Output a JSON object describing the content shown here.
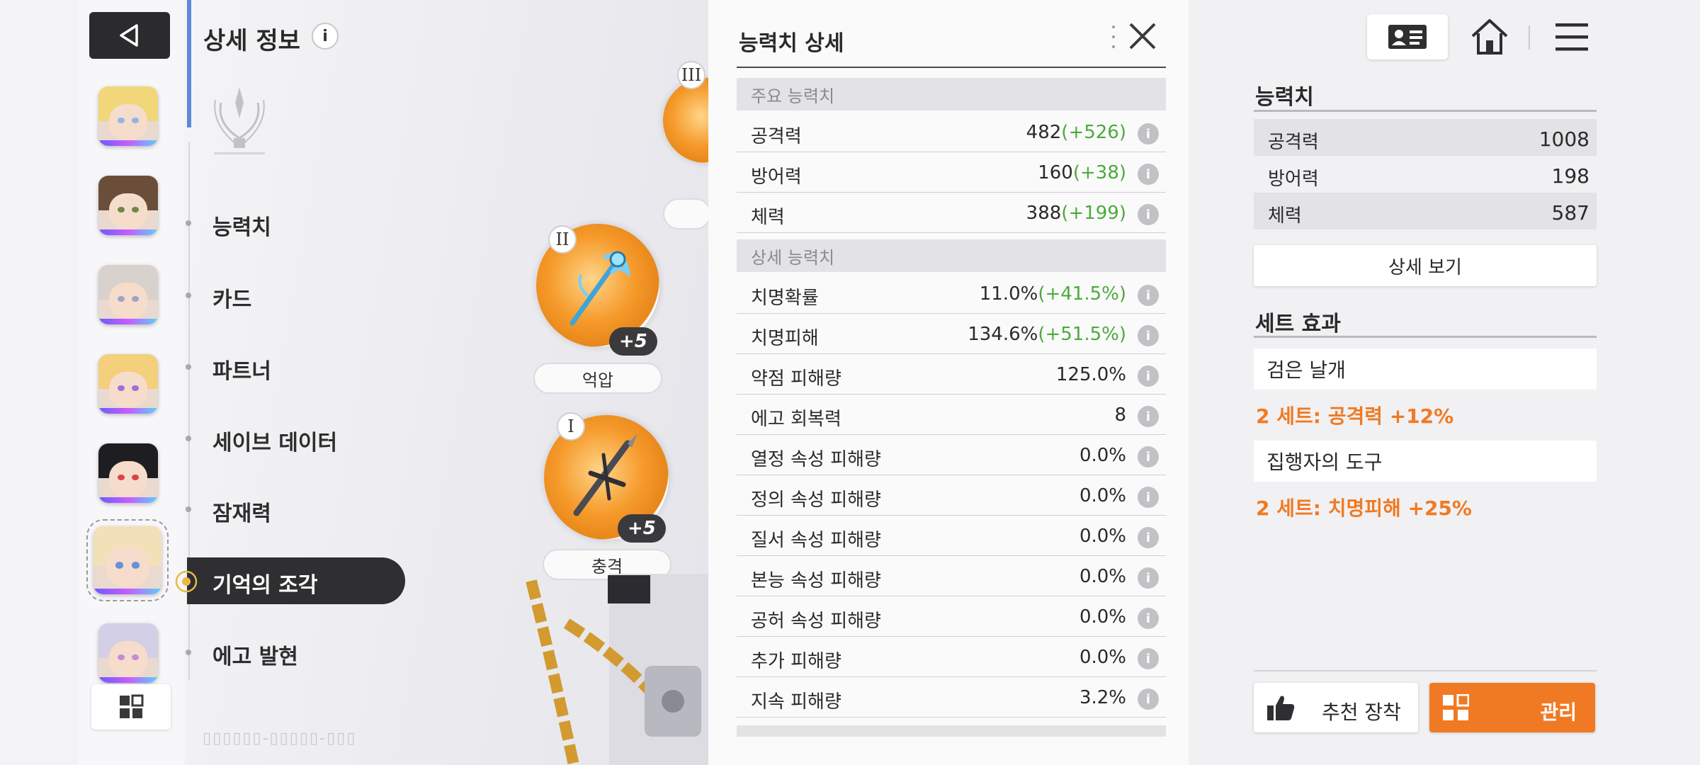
{
  "left_menu": {
    "title": "상세 정보",
    "info_glyph": "i",
    "items": [
      {
        "label": "능력치"
      },
      {
        "label": "카드"
      },
      {
        "label": "파트너"
      },
      {
        "label": "세이브 데이터"
      },
      {
        "label": "잠재력"
      },
      {
        "label": "기억의 조각"
      },
      {
        "label": "에고 발현"
      }
    ],
    "active_index": 5
  },
  "characters": {
    "count": 7,
    "selected_index": 5,
    "hair_colors": [
      "#f2d77a",
      "#6b4e3a",
      "#d9d2cc",
      "#f4cf7c",
      "#1e1e22",
      "#f1e0b8",
      "#d2cfe6"
    ],
    "eye_colors": [
      "#8fb5e8",
      "#6a8a4a",
      "#9aa6c2",
      "#a66cd8",
      "#d84646",
      "#6b8fd8",
      "#c78ad6"
    ]
  },
  "fragments": [
    {
      "roman": "III",
      "plus": "",
      "name": ""
    },
    {
      "roman": "II",
      "plus": "+5",
      "name": "억압"
    },
    {
      "roman": "I",
      "plus": "+5",
      "name": "충격"
    }
  ],
  "stats_panel": {
    "title": "능력치 상세",
    "main_section": "주요 능력치",
    "main_stats": [
      {
        "label": "공격력",
        "base": "482",
        "bonus": "(+526)"
      },
      {
        "label": "방어력",
        "base": "160",
        "bonus": "(+38)"
      },
      {
        "label": "체력",
        "base": "388",
        "bonus": "(+199)"
      }
    ],
    "detail_section": "상세 능력치",
    "detail_stats": [
      {
        "label": "치명확률",
        "base": "11.0%",
        "bonus": "(+41.5%)"
      },
      {
        "label": "치명피해",
        "base": "134.6%",
        "bonus": "(+51.5%)"
      },
      {
        "label": "약점 피해량",
        "base": "125.0%",
        "bonus": ""
      },
      {
        "label": "에고 회복력",
        "base": "8",
        "bonus": ""
      },
      {
        "label": "열정 속성 피해량",
        "base": "0.0%",
        "bonus": ""
      },
      {
        "label": "정의 속성 피해량",
        "base": "0.0%",
        "bonus": ""
      },
      {
        "label": "질서 속성 피해량",
        "base": "0.0%",
        "bonus": ""
      },
      {
        "label": "본능 속성 피해량",
        "base": "0.0%",
        "bonus": ""
      },
      {
        "label": "공허 속성 피해량",
        "base": "0.0%",
        "bonus": ""
      },
      {
        "label": "추가 피해량",
        "base": "0.0%",
        "bonus": ""
      },
      {
        "label": "지속 피해량",
        "base": "3.2%",
        "bonus": ""
      }
    ],
    "info_glyph": "i"
  },
  "summary": {
    "stats_heading": "능력치",
    "stats": [
      {
        "label": "공격력",
        "value": "1008"
      },
      {
        "label": "방어력",
        "value": "198"
      },
      {
        "label": "체력",
        "value": "587"
      }
    ],
    "detail_button": "상세 보기",
    "set_heading": "세트 효과",
    "sets": [
      {
        "name": "검은 날개",
        "effect": "2 세트: 공격력 +12%"
      },
      {
        "name": "집행자의 도구",
        "effect": "2 세트: 치명피해 +25%"
      }
    ],
    "recommend_button": "추천 장착",
    "manage_button": "관리"
  },
  "icons": {
    "back": "back-triangle-icon",
    "grid": "grid-icon",
    "close": "close-icon",
    "profile": "profile-card-icon",
    "home": "home-icon",
    "menu": "hamburger-menu-icon",
    "thumbs_up": "thumbs-up-icon",
    "manage": "manage-grid-icon"
  },
  "colors": {
    "bonus_green": "#4caa3c",
    "accent_orange": "#f07a23",
    "dark_button": "#2b2b2d"
  }
}
